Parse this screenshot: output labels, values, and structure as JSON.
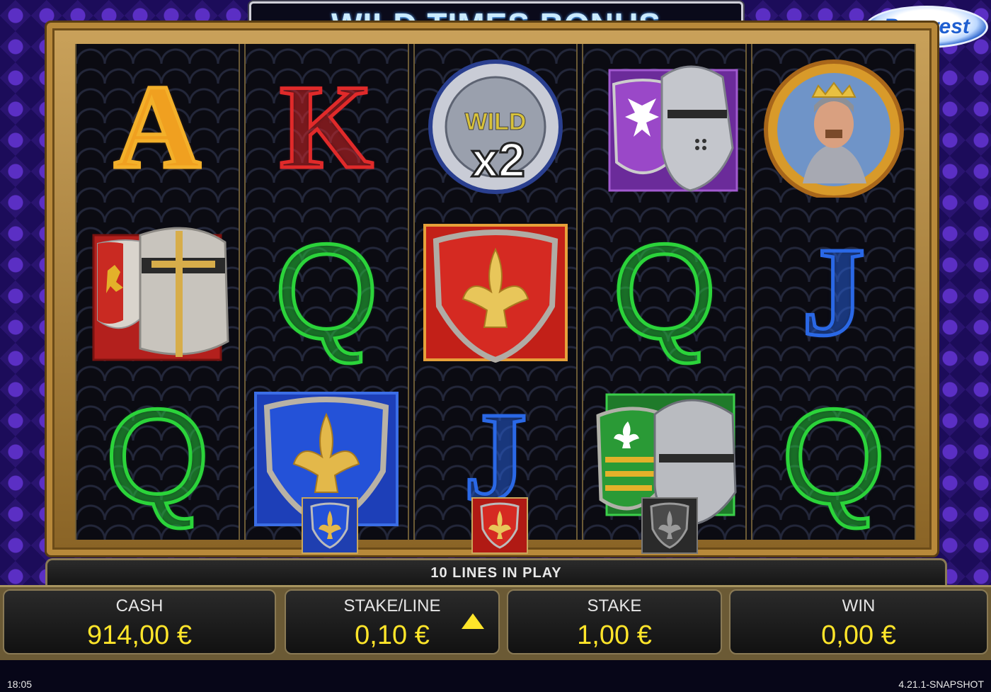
{
  "header": {
    "title": "WILD TIMES BONUS",
    "logo_text": "Barcrest"
  },
  "reels": [
    {
      "symbols": [
        {
          "type": "letter",
          "value": "A",
          "color": "#f0a020"
        },
        {
          "type": "icon",
          "name": "red-lion-shield-helmet"
        },
        {
          "type": "letter",
          "value": "Q",
          "color": "#2bd43a"
        }
      ]
    },
    {
      "symbols": [
        {
          "type": "letter",
          "value": "K",
          "color": "#e02a2a"
        },
        {
          "type": "letter",
          "value": "Q",
          "color": "#2bd43a"
        },
        {
          "type": "icon",
          "name": "blue-fleur-shield"
        }
      ]
    },
    {
      "symbols": [
        {
          "type": "icon",
          "name": "wild-x2-coin",
          "wild_text": "WILD",
          "multiplier_text": "x2"
        },
        {
          "type": "icon",
          "name": "red-fleur-shield"
        },
        {
          "type": "letter",
          "value": "J",
          "color": "#2a68e6"
        }
      ]
    },
    {
      "symbols": [
        {
          "type": "icon",
          "name": "purple-eagle-shield-helmet"
        },
        {
          "type": "letter",
          "value": "Q",
          "color": "#2bd43a"
        },
        {
          "type": "icon",
          "name": "green-shield-helmet"
        }
      ]
    },
    {
      "symbols": [
        {
          "type": "icon",
          "name": "king-portrait"
        },
        {
          "type": "letter",
          "value": "J",
          "color": "#2a68e6"
        },
        {
          "type": "letter",
          "value": "Q",
          "color": "#2bd43a"
        }
      ]
    }
  ],
  "mini_shields": [
    {
      "name": "blue-fleur-shield-mini-icon",
      "color": "#1f4fd0"
    },
    {
      "name": "red-fleur-shield-mini-icon",
      "color": "#c8201a"
    },
    {
      "name": "gray-fleur-shield-mini-icon",
      "color": "#4a4a4a"
    }
  ],
  "bottom": {
    "lines_in_play": "10 LINES IN PLAY",
    "cash": {
      "label": "CASH",
      "value": "914,00 €"
    },
    "stake_line": {
      "label": "STAKE/LINE",
      "value": "0,10 €"
    },
    "stake": {
      "label": "STAKE",
      "value": "1,00 €"
    },
    "win": {
      "label": "WIN",
      "value": "0,00 €"
    }
  },
  "status": {
    "clock": "18:05",
    "version": "4.21.1-SNAPSHOT"
  }
}
